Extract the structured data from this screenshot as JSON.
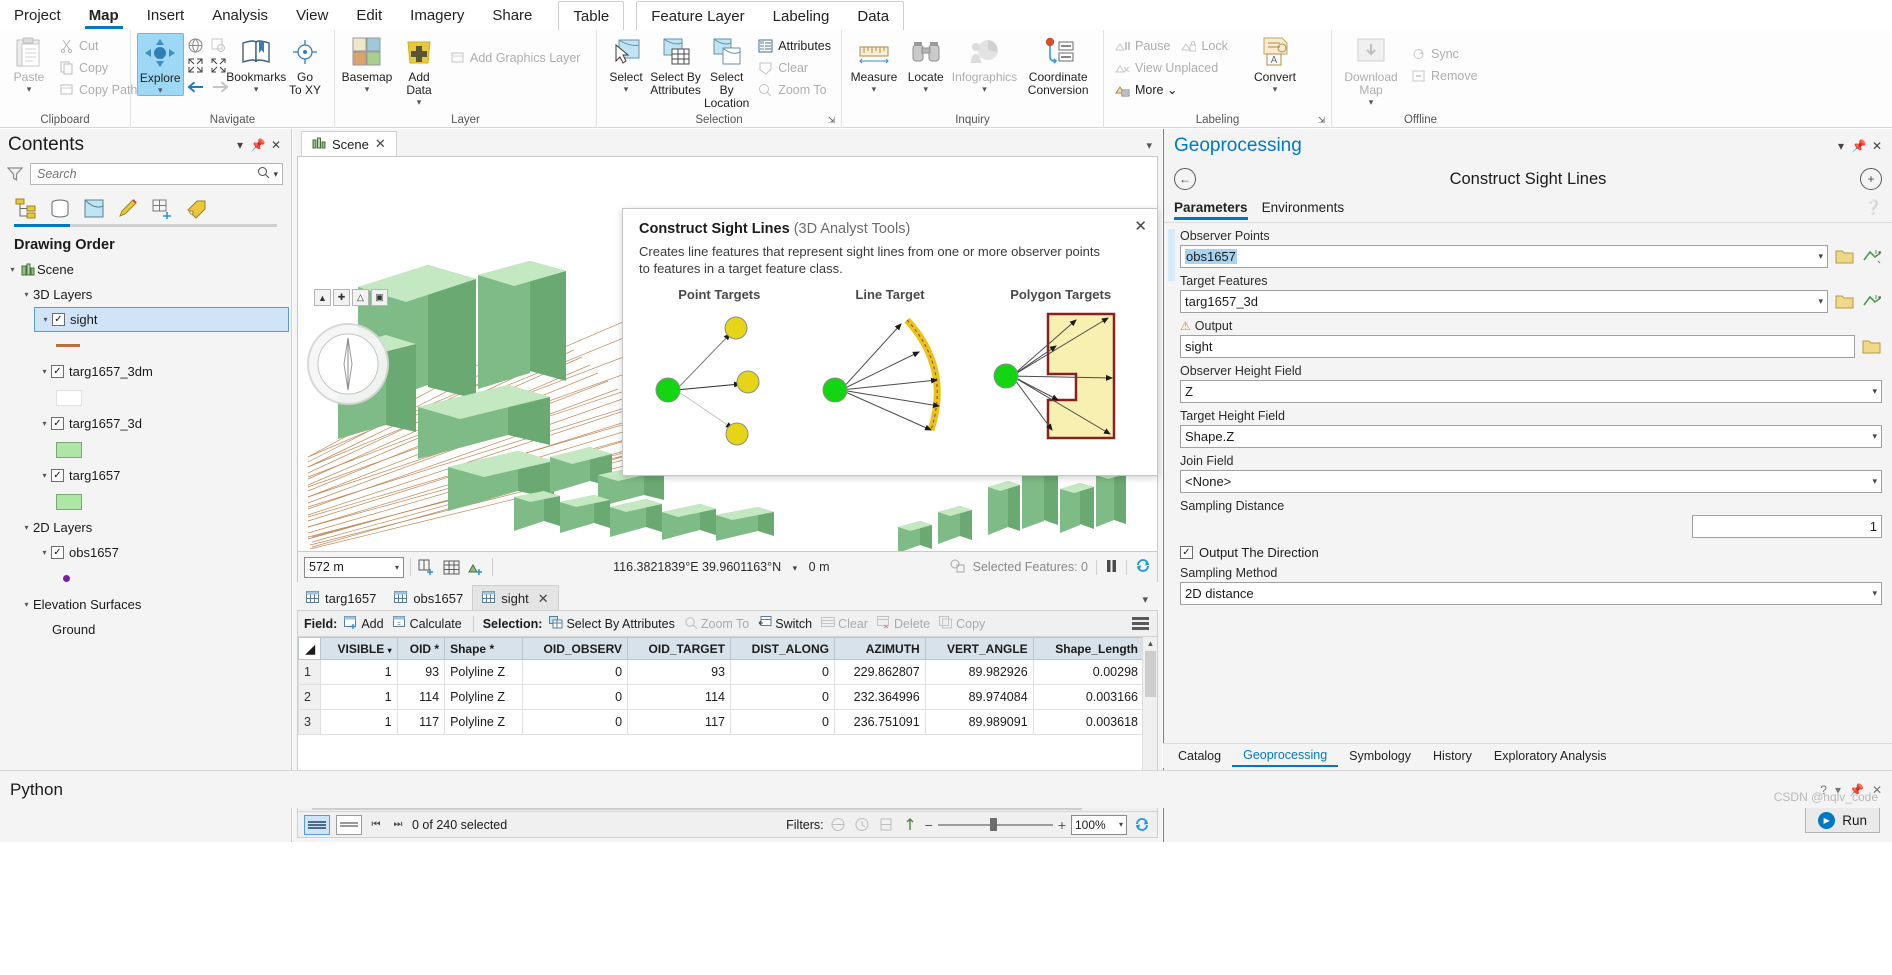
{
  "ribbon": {
    "tabs": [
      {
        "label": "Project",
        "active": false
      },
      {
        "label": "Map",
        "active": true
      },
      {
        "label": "Insert",
        "active": false
      },
      {
        "label": "Analysis",
        "active": false
      },
      {
        "label": "View",
        "active": false
      },
      {
        "label": "Edit",
        "active": false
      },
      {
        "label": "Imagery",
        "active": false
      },
      {
        "label": "Share",
        "active": false
      }
    ],
    "contextual_single": {
      "label": "Table"
    },
    "contextual_group": [
      {
        "label": "Feature Layer"
      },
      {
        "label": "Labeling"
      },
      {
        "label": "Data"
      }
    ],
    "groups": [
      {
        "title": "Clipboard",
        "big": [
          {
            "label": "Paste",
            "caret": "⌄",
            "disabled": true,
            "icon": "paste-icon"
          }
        ],
        "small": [
          {
            "label": "Cut",
            "icon": "cut-icon",
            "disabled": true
          },
          {
            "label": "Copy",
            "icon": "copy-icon",
            "disabled": true
          },
          {
            "label": "Copy Path",
            "icon": "copy-path-icon",
            "disabled": true
          }
        ]
      },
      {
        "title": "Navigate",
        "big": [
          {
            "label": "Explore",
            "caret": "⌄",
            "selected": true,
            "icon": "explore-icon"
          },
          {
            "label": "Bookmarks",
            "caret": "⌄",
            "icon": "bookmarks-icon"
          },
          {
            "label": "Go\nTo XY",
            "icon": "go-to-xy-icon"
          }
        ],
        "mini": [
          "full-extent-icon",
          "fixed-zoom-icon",
          "zoom-in-icon",
          "zoom-out-icon",
          "previous-extent-icon",
          "next-extent-icon"
        ]
      },
      {
        "title": "Layer",
        "big": [
          {
            "label": "Basemap",
            "caret": "⌄",
            "icon": "basemap-icon"
          },
          {
            "label": "Add\nData",
            "caret": "⌄",
            "icon": "add-data-icon"
          }
        ],
        "small": [
          {
            "label": "Add Graphics Layer",
            "icon": "add-graphics-layer-icon",
            "disabled": true
          }
        ]
      },
      {
        "title": "Selection",
        "big": [
          {
            "label": "Select",
            "caret": "⌄",
            "icon": "select-icon"
          },
          {
            "label": "Select By\nAttributes",
            "icon": "select-by-attributes-icon"
          },
          {
            "label": "Select By\nLocation",
            "icon": "select-by-location-icon"
          }
        ],
        "small": [
          {
            "label": "Attributes",
            "icon": "attributes-icon"
          },
          {
            "label": "Clear",
            "icon": "clear-selection-icon",
            "disabled": true
          },
          {
            "label": "Zoom To",
            "icon": "zoom-to-selection-icon",
            "disabled": true
          }
        ],
        "launcher": true
      },
      {
        "title": "Inquiry",
        "big": [
          {
            "label": "Measure",
            "caret": "⌄",
            "icon": "measure-icon"
          },
          {
            "label": "Locate",
            "caret": "⌄",
            "icon": "locate-icon"
          },
          {
            "label": "Infographics",
            "caret": "⌄",
            "icon": "infographics-icon",
            "disabled": true
          },
          {
            "label": "Coordinate\nConversion",
            "icon": "coordinate-conversion-icon"
          }
        ]
      },
      {
        "title": "Labeling",
        "big": [
          {
            "label": "Convert",
            "caret": "⌄",
            "icon": "convert-labels-icon"
          }
        ],
        "small": [
          {
            "label": "Pause",
            "icon": "pause-labels-icon",
            "disabled": true
          },
          {
            "label": "Lock",
            "icon": "lock-labels-icon",
            "disabled": true
          },
          {
            "label": "View Unplaced",
            "icon": "view-unplaced-icon",
            "disabled": true
          },
          {
            "label": "More ⌄",
            "icon": "more-labels-icon"
          }
        ],
        "launcher": true
      },
      {
        "title": "Offline",
        "big": [
          {
            "label": "Download\nMap",
            "caret": "⌄",
            "icon": "download-map-icon",
            "disabled": true
          }
        ],
        "small": [
          {
            "label": "Sync",
            "icon": "sync-icon",
            "disabled": true
          },
          {
            "label": "Remove",
            "icon": "remove-offline-icon",
            "disabled": true
          }
        ]
      }
    ]
  },
  "contents": {
    "title": "Contents",
    "search_placeholder": "Search",
    "toolbar_icons": [
      "list-by-drawing-order-icon",
      "list-by-data-source-icon",
      "list-by-selection-icon",
      "list-by-editing-icon",
      "list-by-snapping-icon",
      "list-by-labeling-icon"
    ],
    "drawing_order_label": "Drawing Order",
    "tree": [
      {
        "label": "Scene",
        "type": "map",
        "indent": 0,
        "icon": "scene-icon"
      },
      {
        "label": "3D Layers",
        "type": "group",
        "indent": 1
      },
      {
        "label": "sight",
        "type": "layer",
        "indent": 2,
        "checked": true,
        "selected": true,
        "symbol": "line",
        "symbol_color": "#b4743c"
      },
      {
        "label": "targ1657_3dm",
        "type": "layer",
        "indent": 2,
        "checked": true,
        "symbol": "fill",
        "symbol_color": "#ffffff"
      },
      {
        "label": "targ1657_3d",
        "type": "layer",
        "indent": 2,
        "checked": true,
        "symbol": "fill",
        "symbol_color": "#aee6a6"
      },
      {
        "label": "targ1657",
        "type": "layer",
        "indent": 2,
        "checked": true,
        "symbol": "fill",
        "symbol_color": "#aee6a6"
      },
      {
        "label": "2D Layers",
        "type": "group",
        "indent": 1
      },
      {
        "label": "obs1657",
        "type": "layer",
        "indent": 2,
        "checked": true,
        "symbol": "point",
        "symbol_color": "#7b1fa2"
      },
      {
        "label": "Elevation Surfaces",
        "type": "group",
        "indent": 1
      },
      {
        "label": "Ground",
        "type": "surface",
        "indent": 2
      }
    ]
  },
  "view": {
    "tab_label": "Scene",
    "scale": "572 m",
    "coordinates": "116.3821839°E 39.9601163°N",
    "elevation": "0 m",
    "selected_features": "Selected Features: 0"
  },
  "table": {
    "tabs": [
      {
        "label": "targ1657",
        "active": false
      },
      {
        "label": "obs1657",
        "active": false
      },
      {
        "label": "sight",
        "active": true,
        "closable": true
      }
    ],
    "toolbar": {
      "field_label": "Field:",
      "add": "Add",
      "calculate": "Calculate",
      "selection_label": "Selection:",
      "select_by_attributes": "Select By Attributes",
      "zoom_to": "Zoom To",
      "switch": "Switch",
      "clear": "Clear",
      "delete": "Delete",
      "copy": "Copy"
    },
    "columns": [
      "VISIBLE",
      "OID *",
      "Shape *",
      "OID_OBSERV",
      "OID_TARGET",
      "DIST_ALONG",
      "AZIMUTH",
      "VERT_ANGLE",
      "Shape_Length"
    ],
    "rows": [
      {
        "num": "1",
        "VISIBLE": "1",
        "OID": "93",
        "Shape": "Polyline Z",
        "OID_OBSERV": "0",
        "OID_TARGET": "93",
        "DIST_ALONG": "0",
        "AZIMUTH": "229.862807",
        "VERT_ANGLE": "89.982926",
        "Shape_Length": "0.00298"
      },
      {
        "num": "2",
        "VISIBLE": "1",
        "OID": "114",
        "Shape": "Polyline Z",
        "OID_OBSERV": "0",
        "OID_TARGET": "114",
        "DIST_ALONG": "0",
        "AZIMUTH": "232.364996",
        "VERT_ANGLE": "89.974084",
        "Shape_Length": "0.003166"
      },
      {
        "num": "3",
        "VISIBLE": "1",
        "OID": "117",
        "Shape": "Polyline Z",
        "OID_OBSERV": "0",
        "OID_TARGET": "117",
        "DIST_ALONG": "0",
        "AZIMUTH": "236.751091",
        "VERT_ANGLE": "89.989091",
        "Shape_Length": "0.003618"
      }
    ],
    "status": {
      "selection_count": "0 of 240 selected",
      "filters_label": "Filters:",
      "zoom_level": "100%"
    }
  },
  "tool_popup": {
    "title": "Construct Sight Lines",
    "toolbox": "(3D Analyst Tools)",
    "description": "Creates line features that represent sight lines from one or more observer points to features in a target feature class.",
    "figures": [
      {
        "caption": "Point Targets"
      },
      {
        "caption": "Line Target"
      },
      {
        "caption": "Polygon Targets"
      }
    ]
  },
  "geoprocessing": {
    "pane_title": "Geoprocessing",
    "tool_name": "Construct Sight Lines",
    "tabs": [
      {
        "label": "Parameters",
        "active": true
      },
      {
        "label": "Environments",
        "active": false
      }
    ],
    "fields": [
      {
        "label": "Observer Points",
        "value": "obs1657",
        "highlighted": true,
        "dropdown": true,
        "browse": true,
        "extra": "layer-chevron"
      },
      {
        "label": "Target Features",
        "value": "targ1657_3d",
        "dropdown": true,
        "browse": true,
        "extra": "layer-chevron"
      },
      {
        "label": "Output",
        "value": "sight",
        "warning": true,
        "browse": true
      },
      {
        "label": "Observer Height Field",
        "value": "Z",
        "dropdown": true
      },
      {
        "label": "Target Height Field",
        "value": "Shape.Z",
        "dropdown": true
      },
      {
        "label": "Join Field",
        "value": "<None>",
        "dropdown": true
      },
      {
        "label": "Sampling Distance",
        "value": "1",
        "numeric": true
      }
    ],
    "checkbox": {
      "label": "Output The Direction",
      "checked": true
    },
    "sampling_method": {
      "label": "Sampling Method",
      "value": "2D distance"
    },
    "run_button": "Run",
    "bottom_tabs": [
      {
        "label": "Catalog",
        "active": false
      },
      {
        "label": "Geoprocessing",
        "active": true
      },
      {
        "label": "Symbology",
        "active": false
      },
      {
        "label": "History",
        "active": false
      },
      {
        "label": "Exploratory Analysis",
        "active": false
      }
    ]
  },
  "python_bar": {
    "title": "Python"
  },
  "watermark": "CSDN @hqlv_code"
}
